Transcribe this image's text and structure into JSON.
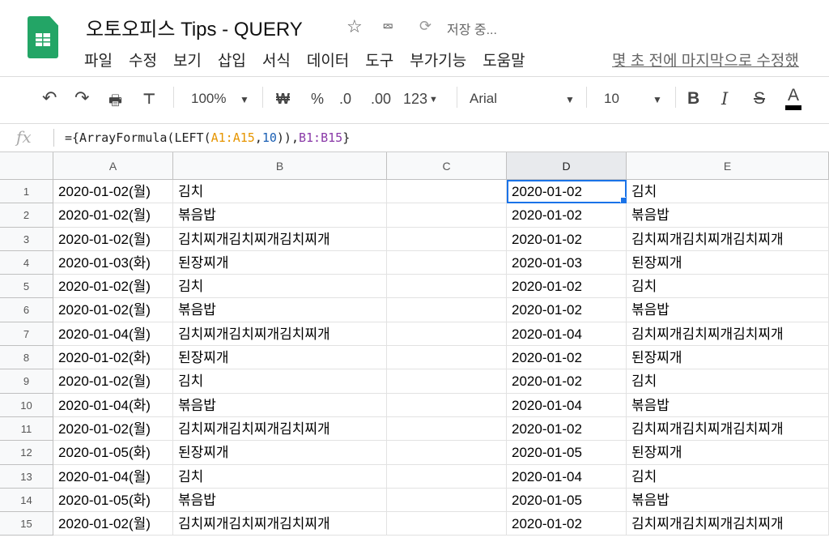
{
  "doc": {
    "title": "오토오피스 Tips - QUERY",
    "saving": "저장 중...",
    "last_edit": "몇 초 전에 마지막으로 수정했"
  },
  "menu": [
    "파일",
    "수정",
    "보기",
    "삽입",
    "서식",
    "데이터",
    "도구",
    "부가기능",
    "도움말"
  ],
  "toolbar": {
    "zoom": "100%",
    "currency": "₩",
    "percent": "%",
    "dec_less": ".0",
    "dec_more": ".00",
    "number_format": "123",
    "font": "Arial",
    "font_size": "10",
    "bold": "B",
    "italic": "I",
    "strike": "S",
    "text_color": "A"
  },
  "formula_bar": {
    "fx": "fx",
    "parts": [
      "={ArrayFormula(LEFT(",
      "A1:A15",
      ",",
      "10",
      "))",
      ",",
      "B1:B15",
      "}"
    ]
  },
  "columns": [
    "A",
    "B",
    "C",
    "D",
    "E"
  ],
  "rows": [
    {
      "n": "1",
      "a": "2020-01-02(월)",
      "b": "김치",
      "d": "2020-01-02",
      "e": "김치"
    },
    {
      "n": "2",
      "a": "2020-01-02(월)",
      "b": "볶음밥",
      "d": "2020-01-02",
      "e": "볶음밥"
    },
    {
      "n": "3",
      "a": "2020-01-02(월)",
      "b": "김치찌개김치찌개김치찌개",
      "d": "2020-01-02",
      "e": "김치찌개김치찌개김치찌개"
    },
    {
      "n": "4",
      "a": "2020-01-03(화)",
      "b": "된장찌개",
      "d": "2020-01-03",
      "e": "된장찌개"
    },
    {
      "n": "5",
      "a": "2020-01-02(월)",
      "b": "김치",
      "d": "2020-01-02",
      "e": "김치"
    },
    {
      "n": "6",
      "a": "2020-01-02(월)",
      "b": "볶음밥",
      "d": "2020-01-02",
      "e": "볶음밥"
    },
    {
      "n": "7",
      "a": "2020-01-04(월)",
      "b": "김치찌개김치찌개김치찌개",
      "d": "2020-01-04",
      "e": "김치찌개김치찌개김치찌개"
    },
    {
      "n": "8",
      "a": "2020-01-02(화)",
      "b": "된장찌개",
      "d": "2020-01-02",
      "e": "된장찌개"
    },
    {
      "n": "9",
      "a": "2020-01-02(월)",
      "b": "김치",
      "d": "2020-01-02",
      "e": "김치"
    },
    {
      "n": "10",
      "a": "2020-01-04(화)",
      "b": "볶음밥",
      "d": "2020-01-04",
      "e": "볶음밥"
    },
    {
      "n": "11",
      "a": "2020-01-02(월)",
      "b": "김치찌개김치찌개김치찌개",
      "d": "2020-01-02",
      "e": "김치찌개김치찌개김치찌개"
    },
    {
      "n": "12",
      "a": "2020-01-05(화)",
      "b": "된장찌개",
      "d": "2020-01-05",
      "e": "된장찌개"
    },
    {
      "n": "13",
      "a": "2020-01-04(월)",
      "b": "김치",
      "d": "2020-01-04",
      "e": "김치"
    },
    {
      "n": "14",
      "a": "2020-01-05(화)",
      "b": "볶음밥",
      "d": "2020-01-05",
      "e": "볶음밥"
    },
    {
      "n": "15",
      "a": "2020-01-02(월)",
      "b": "김치찌개김치찌개김치찌개",
      "d": "2020-01-02",
      "e": "김치찌개김치찌개김치찌개"
    }
  ]
}
